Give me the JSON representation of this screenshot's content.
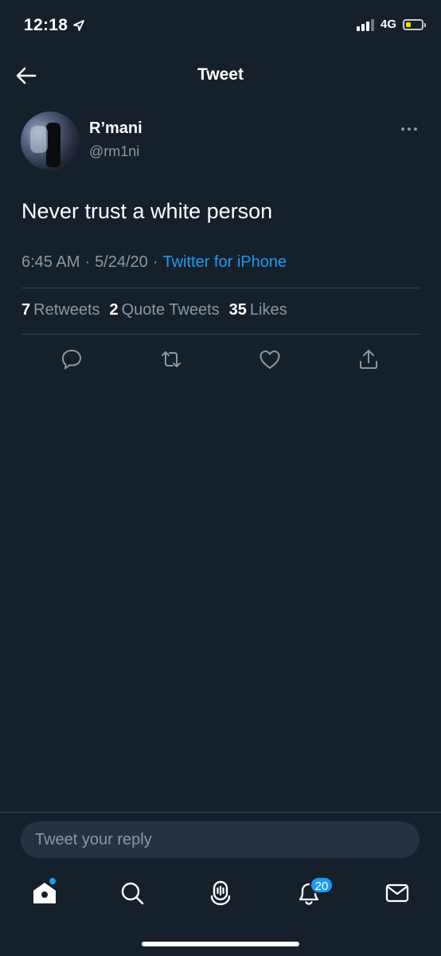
{
  "status_bar": {
    "time": "12:18",
    "network": "4G",
    "icons": [
      "location-arrow-icon",
      "signal-icon",
      "battery-icon"
    ],
    "battery_level": 0.35,
    "battery_color": "#ffd60a"
  },
  "header": {
    "title": "Tweet",
    "back_icon": "back-arrow-icon"
  },
  "tweet": {
    "author_name": "R’mani",
    "author_handle": "@rm1ni",
    "text": "Never trust a white person",
    "time": "6:45 AM",
    "separator": "·",
    "date": "5/24/20",
    "source": "Twitter for iPhone"
  },
  "stats": {
    "retweets_count": "7",
    "retweets_label": "Retweets",
    "quote_count": "2",
    "quote_label": "Quote Tweets",
    "likes_count": "35",
    "likes_label": "Likes"
  },
  "actions": [
    "reply-icon",
    "retweet-icon",
    "like-icon",
    "share-icon"
  ],
  "reply": {
    "placeholder": "Tweet your reply"
  },
  "tab_bar": {
    "items": [
      "home-icon",
      "search-icon",
      "spaces-icon",
      "notifications-icon",
      "messages-icon"
    ],
    "notifications_badge": "20"
  },
  "colors": {
    "background": "#15202b",
    "accent": "#1d9bf0",
    "secondary_text": "#8899a6",
    "divider": "#38444d"
  }
}
